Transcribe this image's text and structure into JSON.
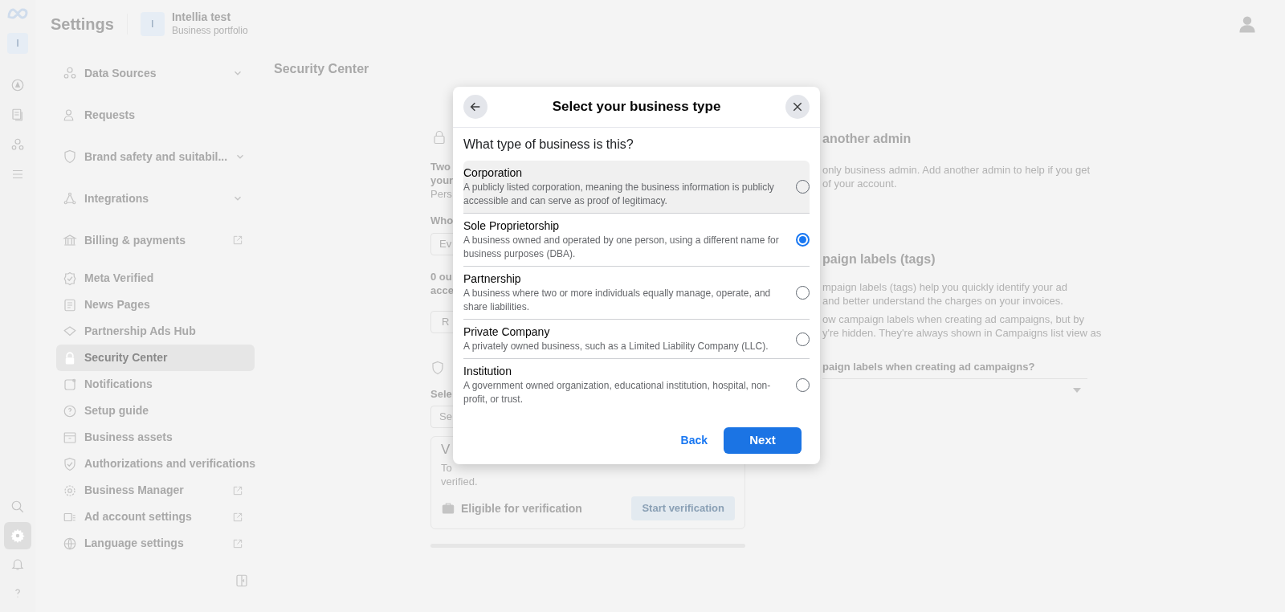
{
  "rail": {
    "account_letter": "I",
    "bottom_items": [
      {
        "kind": "search",
        "selected": false
      },
      {
        "kind": "settings",
        "selected": true
      },
      {
        "kind": "notifications",
        "selected": false
      },
      {
        "kind": "help",
        "selected": false
      }
    ]
  },
  "header": {
    "title": "Settings",
    "portfolio_letter": "I",
    "portfolio_name": "Intellia test",
    "portfolio_type": "Business portfolio"
  },
  "sidebar": {
    "items": [
      {
        "label": "Data Sources",
        "expandable": true,
        "selected": false
      },
      {
        "label": "Requests",
        "selected": false
      },
      {
        "label": "Brand safety and suitabil...",
        "expandable": true,
        "selected": false
      },
      {
        "label": "Integrations",
        "expandable": true,
        "selected": false
      },
      {
        "label": "Billing & payments",
        "external": true,
        "selected": false
      },
      {
        "label": "Meta Verified",
        "selected": false
      },
      {
        "label": "News Pages",
        "selected": false
      },
      {
        "label": "Partnership Ads Hub",
        "selected": false
      },
      {
        "label": "Security Center",
        "selected": true
      },
      {
        "label": "Notifications",
        "selected": false
      },
      {
        "label": "Setup guide",
        "selected": false
      },
      {
        "label": "Business assets",
        "selected": false
      },
      {
        "label": "Authorizations and verifications",
        "selected": false
      },
      {
        "label": "Business Manager",
        "external": true,
        "selected": false
      },
      {
        "label": "Ad account settings",
        "external": true,
        "selected": false
      },
      {
        "label": "Language settings",
        "external": true,
        "selected": false
      }
    ]
  },
  "page_title": "Security Center",
  "security_panel": {
    "two_factor_lines": [
      "Two",
      "your",
      "Pers"
    ],
    "who_label": "Who",
    "who_field": "Ev",
    "admins_lines": [
      "0 ou",
      "acce"
    ],
    "button": "R",
    "select_label": "Sele",
    "select_field": "Se",
    "verify_title": "V",
    "verify_lines": [
      "To",
      "verified."
    ],
    "eligible": "Eligible for verification",
    "start_button": "Start verification"
  },
  "right_panel": {
    "admin_title": "another admin",
    "admin_lines": [
      "only business admin. Add another admin to help if you get",
      "of your account."
    ],
    "labels_title": "paign labels (tags)",
    "labels_lines": [
      "mpaign labels (tags) help you quickly identify your ad",
      "and better understand the charges on your invoices."
    ],
    "labels_lines_2": [
      "ow campaign labels when creating ad campaigns, but by",
      "y're hidden. They're always shown in Campaigns list view as"
    ],
    "question": "paign labels when creating ad campaigns?"
  },
  "modal": {
    "title": "Select your business type",
    "question": "What type of business is this?",
    "options": [
      {
        "title": "Corporation",
        "description": "A publicly listed corporation, meaning the business information is publicly accessible and can serve as proof of legitimacy.",
        "selected": false,
        "hovered": true
      },
      {
        "title": "Sole Proprietorship",
        "description": "A business owned and operated by one person, using a different name for business purposes (DBA).",
        "selected": true,
        "hovered": false
      },
      {
        "title": "Partnership",
        "description": "A business where two or more individuals equally manage, operate, and share liabilities.",
        "selected": false,
        "hovered": false
      },
      {
        "title": "Private Company",
        "description": "A privately owned business, such as a Limited Liability Company (LLC).",
        "selected": false,
        "hovered": false
      },
      {
        "title": "Institution",
        "description": "A government owned organization, educational institution, hospital, non-profit, or trust.",
        "selected": false,
        "hovered": false
      }
    ],
    "back_button": "Back",
    "next_button": "Next"
  }
}
